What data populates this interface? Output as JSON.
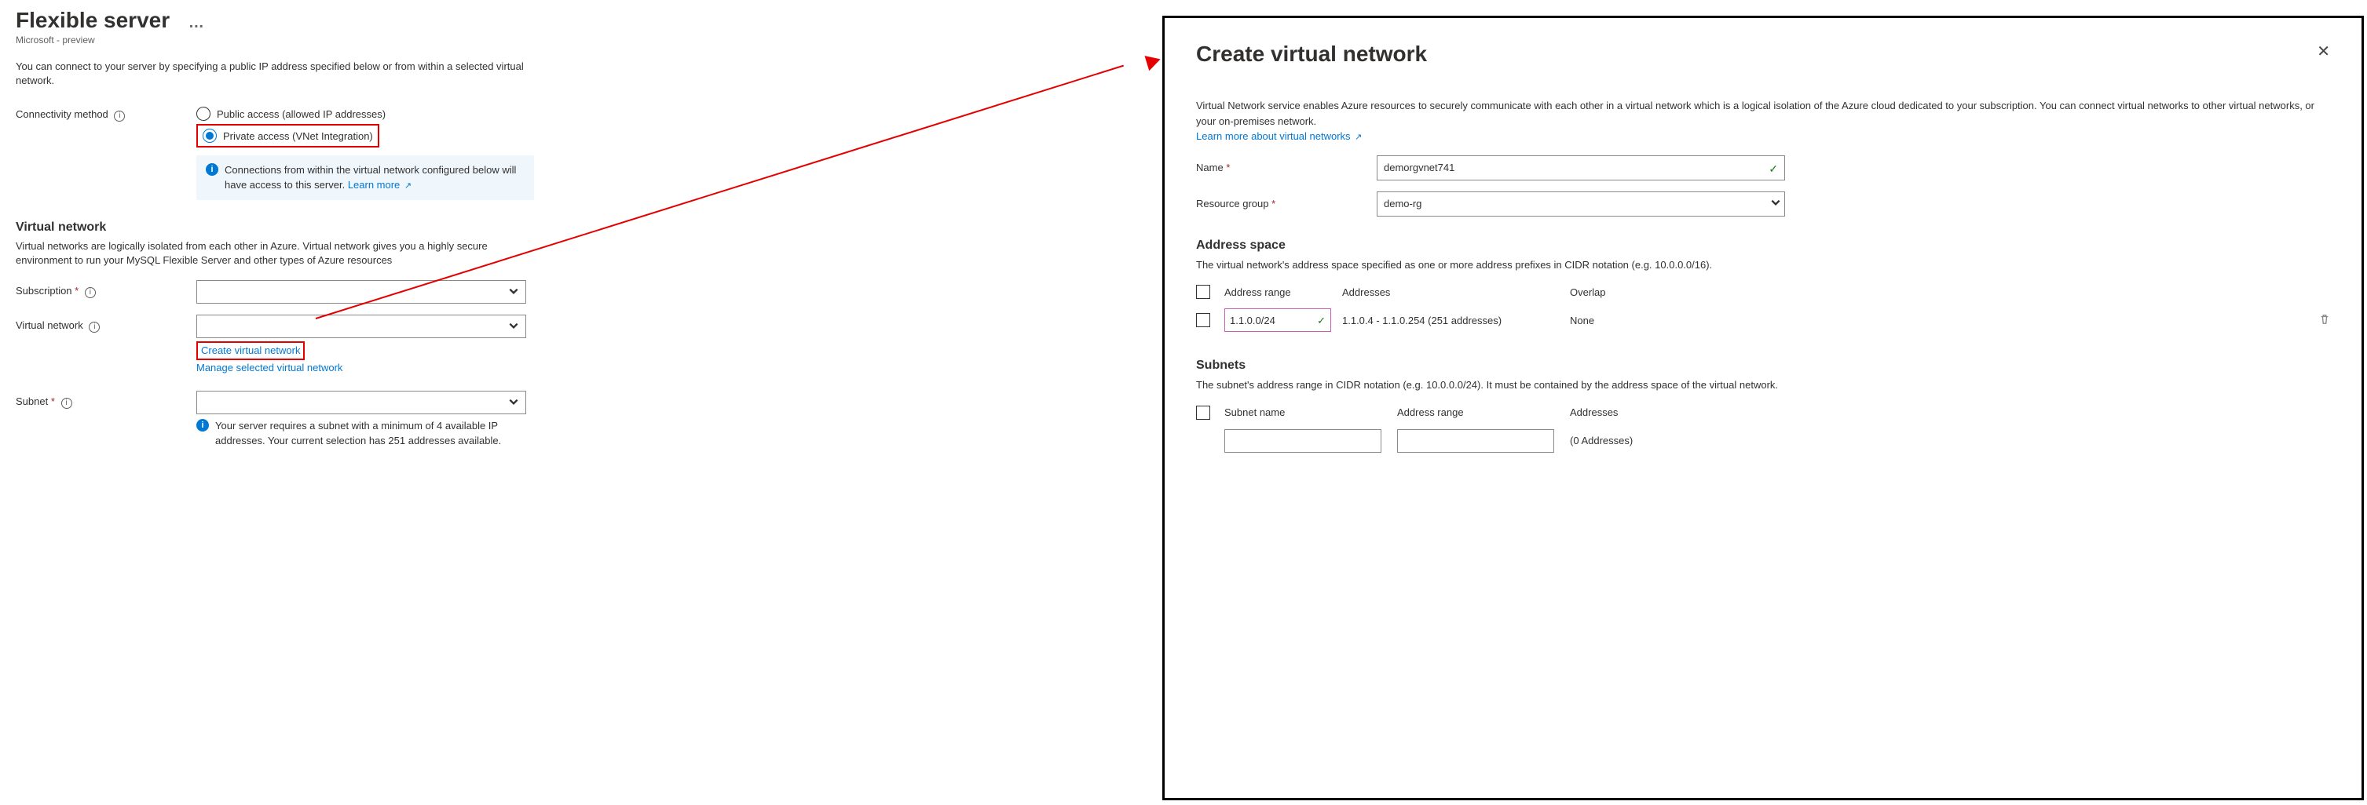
{
  "left": {
    "title": "Flexible server",
    "subtitle": "Microsoft - preview",
    "intro": "You can connect to your server by specifying a public IP address specified below or from within a selected virtual network.",
    "connectivity_label": "Connectivity method",
    "radio_public": "Public access (allowed IP addresses)",
    "radio_private": "Private access (VNet Integration)",
    "banner_text": "Connections from within the virtual network configured below will have access to this server.",
    "banner_link": "Learn more",
    "vnet_heading": "Virtual network",
    "vnet_desc": "Virtual networks are logically isolated from each other in Azure. Virtual network gives you a highly secure environment to run your MySQL Flexible Server and other types of Azure resources",
    "subscription_label": "Subscription",
    "virtual_network_label": "Virtual network",
    "create_vnet_link": "Create virtual network",
    "manage_vnet_link": "Manage selected virtual network",
    "subnet_label": "Subnet",
    "note": "Your server requires a subnet with a minimum of 4 available IP addresses. Your current selection has 251 addresses available."
  },
  "right": {
    "title": "Create virtual network",
    "desc": "Virtual Network service enables Azure resources to securely communicate with each other in a virtual network which is a logical isolation of the Azure cloud dedicated to your subscription. You can connect virtual networks to other virtual networks, or your on-premises network.",
    "learn_link": "Learn more about virtual networks",
    "name_label": "Name",
    "name_value": "demorgvnet741",
    "rg_label": "Resource group",
    "rg_value": "demo-rg",
    "addr_space_heading": "Address space",
    "addr_space_desc": "The virtual network's address space specified as one or more address prefixes in CIDR notation (e.g. 10.0.0.0/16).",
    "addr_range_head": "Address range",
    "addresses_head": "Addresses",
    "overlap_head": "Overlap",
    "row_range": "1.1.0.0/24",
    "row_addresses": "1.1.0.4 - 1.1.0.254 (251 addresses)",
    "row_overlap": "None",
    "subnets_heading": "Subnets",
    "subnets_desc": "The subnet's address range in CIDR notation (e.g. 10.0.0.0/24). It must be contained by the address space of the virtual network.",
    "subnet_name_head": "Subnet name",
    "subnet_range_head": "Address range",
    "subnet_addr_head": "Addresses",
    "subnet_addr_value": "(0 Addresses)"
  }
}
